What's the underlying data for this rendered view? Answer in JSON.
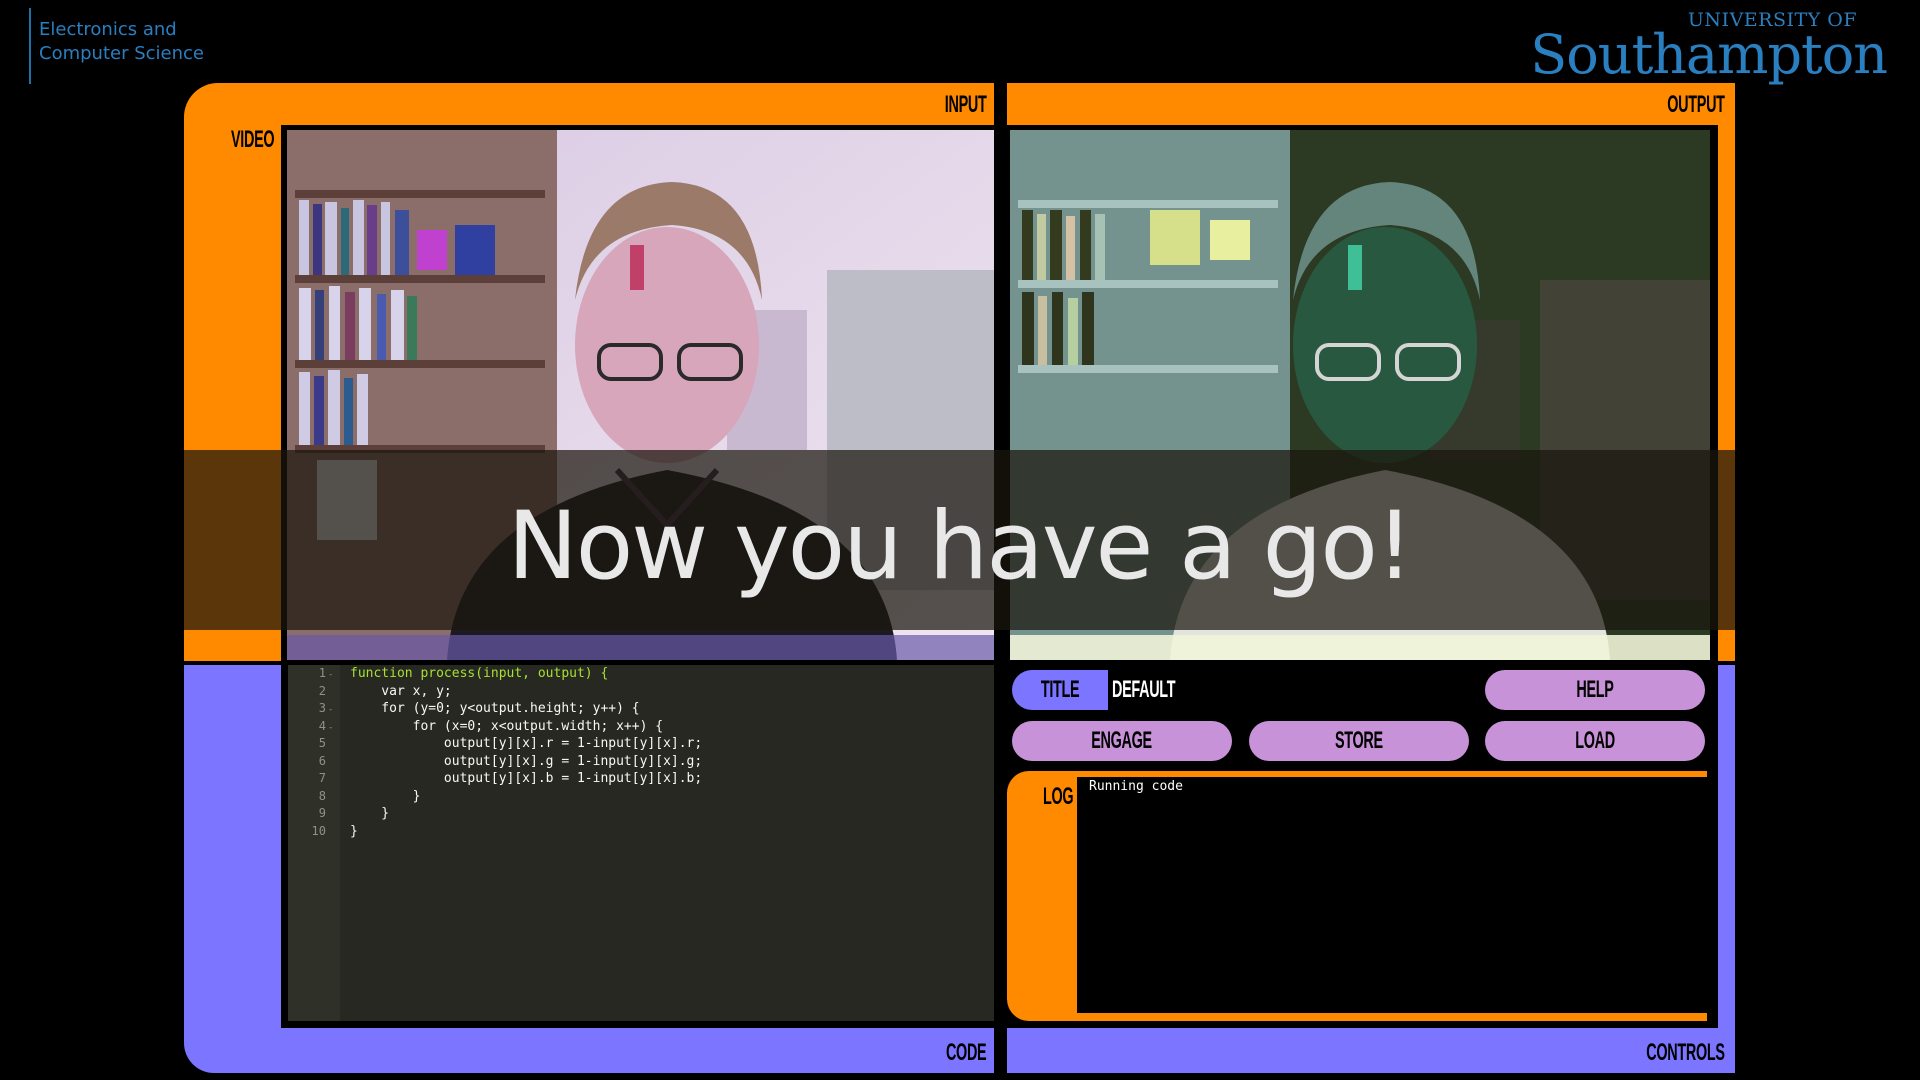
{
  "header": {
    "department_line1": "Electronics and",
    "department_line2": "Computer Science",
    "university_small": "UNIVERSITY OF",
    "university_big": "Southampton"
  },
  "input_panel": {
    "label": "INPUT",
    "side_label": "VIDEO"
  },
  "output_panel": {
    "label": "OUTPUT"
  },
  "code_panel": {
    "label": "CODE",
    "lines": [
      {
        "num": "1",
        "fold": true,
        "text": "function process(input, output) {"
      },
      {
        "num": "2",
        "fold": false,
        "text": "    var x, y;"
      },
      {
        "num": "3",
        "fold": true,
        "text": "    for (y=0; y<output.height; y++) {"
      },
      {
        "num": "4",
        "fold": true,
        "text": "        for (x=0; x<output.width; x++) {"
      },
      {
        "num": "5",
        "fold": false,
        "text": "            output[y][x].r = 1-input[y][x].r;"
      },
      {
        "num": "6",
        "fold": false,
        "text": "            output[y][x].g = 1-input[y][x].g;"
      },
      {
        "num": "7",
        "fold": false,
        "text": "            output[y][x].b = 1-input[y][x].b;"
      },
      {
        "num": "8",
        "fold": false,
        "text": "        }"
      },
      {
        "num": "9",
        "fold": false,
        "text": "    }"
      },
      {
        "num": "10",
        "fold": false,
        "text": "}"
      }
    ]
  },
  "controls_panel": {
    "label": "CONTROLS",
    "title_button": "TITLE",
    "title_value": "DEFAULT",
    "help_button": "HELP",
    "engage_button": "ENGAGE",
    "store_button": "STORE",
    "load_button": "LOAD",
    "log_label": "LOG",
    "log_text": "Running code"
  },
  "banner": {
    "text": "Now you have a go!"
  },
  "colors": {
    "orange": "#ff8a00",
    "purple": "#7b75ff",
    "lilac": "#c792d8",
    "brand_blue": "#2a7fc0"
  }
}
